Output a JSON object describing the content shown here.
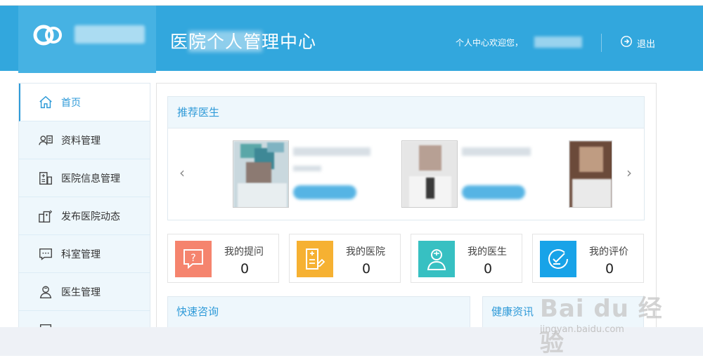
{
  "header": {
    "site_title": "医院个人管理中心",
    "welcome_text": "个人中心欢迎您，",
    "logout_label": "退出"
  },
  "sidebar": {
    "items": [
      {
        "label": "首页",
        "icon": "home-icon",
        "active": true
      },
      {
        "label": "资料管理",
        "icon": "profile-card-icon"
      },
      {
        "label": "医院信息管理",
        "icon": "hospital-info-icon"
      },
      {
        "label": "发布医院动态",
        "icon": "hospital-post-icon"
      },
      {
        "label": "科室管理",
        "icon": "department-chat-icon"
      },
      {
        "label": "医生管理",
        "icon": "doctor-icon"
      }
    ]
  },
  "recommend": {
    "title": "推荐医生",
    "prev_arrow": "‹",
    "next_arrow": "›"
  },
  "stats": [
    {
      "label": "我的提问",
      "value": "0",
      "icon": "question-icon",
      "color": "#f5846e"
    },
    {
      "label": "我的医院",
      "value": "0",
      "icon": "hospital-icon",
      "color": "#f6b132"
    },
    {
      "label": "我的医生",
      "value": "0",
      "icon": "doctor-avatar-icon",
      "color": "#37c0c2"
    },
    {
      "label": "我的评价",
      "value": "0",
      "icon": "review-icon",
      "color": "#18a3e8"
    }
  ],
  "sections": {
    "quick_consult": "快速咨询",
    "health_news": "健康资讯"
  },
  "watermark": {
    "brand": "Bai du 经验",
    "url": "jingyan.baidu.com"
  },
  "colors": {
    "header_bg": "#32a7dd",
    "accent": "#2e9ad8",
    "panel_bg": "#eef7fc"
  }
}
